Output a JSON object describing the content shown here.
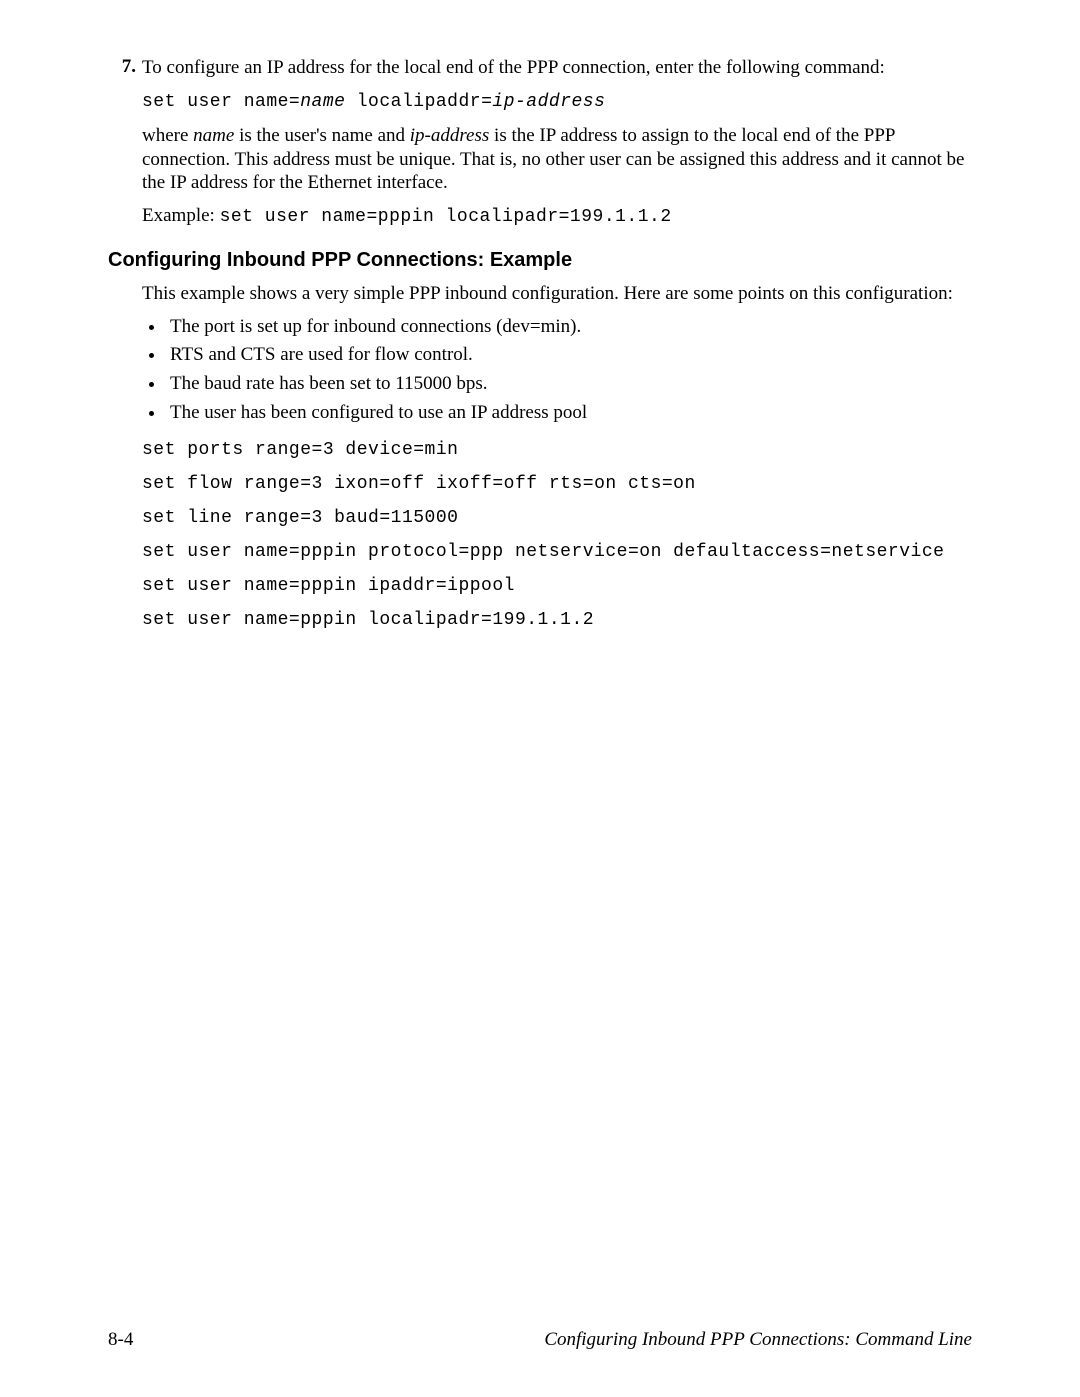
{
  "step": {
    "number": "7.",
    "text": "To configure an IP address for the local end of the PPP connection, enter the following command:",
    "cmd_prefix": "set user name=",
    "cmd_param1": "name",
    "cmd_mid": " localipaddr=",
    "cmd_param2": "ip-address",
    "where_p1": "where ",
    "where_i1": "name",
    "where_p2": " is the user's name and ",
    "where_i2": "ip-address",
    "where_p3": " is the IP address to assign to the local end of the PPP connection. This address must be unique. That is, no other user can be assigned this address and it cannot be the IP address for the Ethernet interface.",
    "example_label": "Example: ",
    "example_code": "set user name=pppin localipadr=199.1.1.2"
  },
  "section_title": "Configuring Inbound PPP Connections: Example",
  "intro": "This example shows a very simple PPP inbound configuration. Here are some points on this configuration:",
  "bullets": [
    "The port is set up for inbound connections (dev=min).",
    "RTS and CTS are used for flow control.",
    "The baud rate has been set to 115000 bps.",
    "The user has been configured to use an IP address pool"
  ],
  "code_lines": [
    "set ports range=3 device=min",
    "set flow range=3 ixon=off ixoff=off rts=on cts=on",
    "set line range=3 baud=115000",
    "set user name=pppin protocol=ppp netservice=on defaultaccess=netservice",
    "set user name=pppin ipaddr=ippool",
    "set user name=pppin localipadr=199.1.1.2"
  ],
  "footer": {
    "page": "8-4",
    "title": "Configuring Inbound PPP Connections: Command Line"
  }
}
